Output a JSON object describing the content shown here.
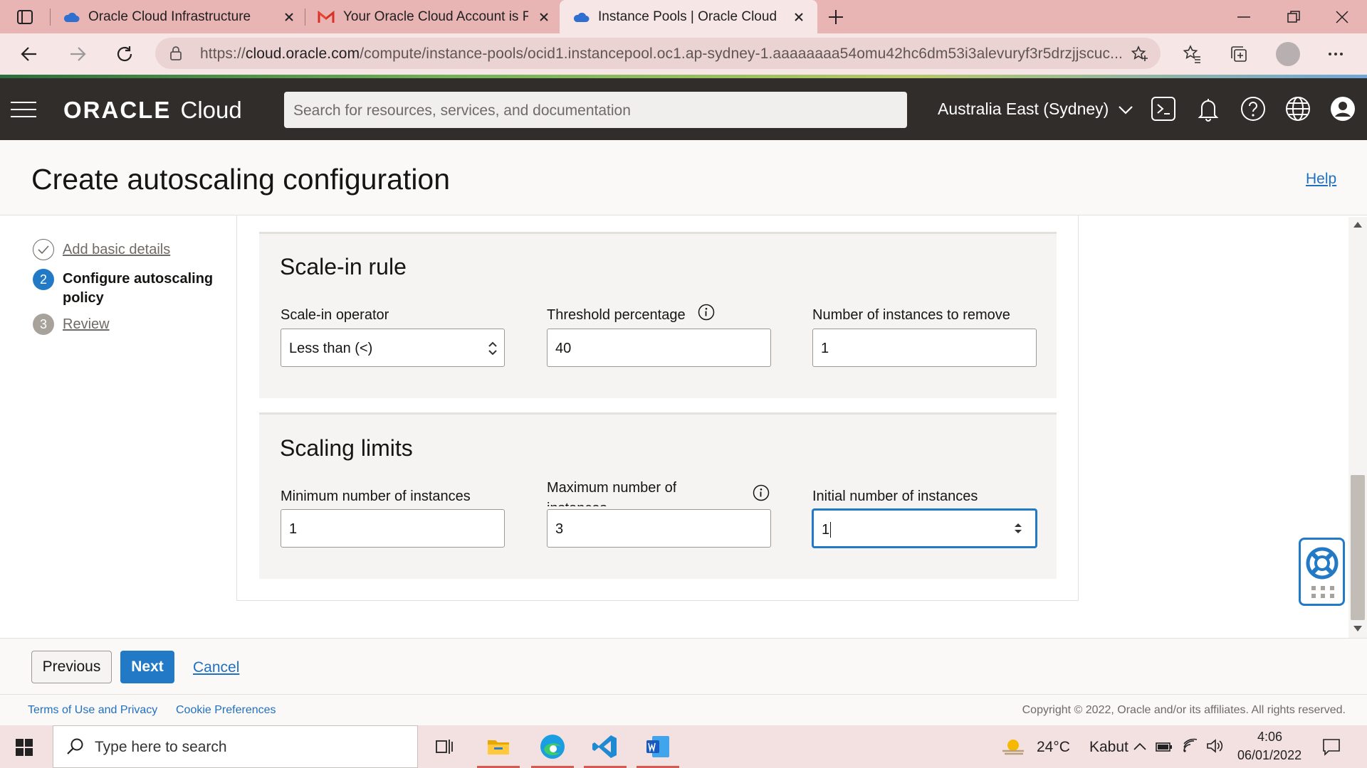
{
  "browser": {
    "tabs": [
      {
        "title": "Oracle Cloud Infrastructure | Sign In",
        "icon": "cloud-icon"
      },
      {
        "title": "Your Oracle Cloud Account is Fully Provisioned",
        "icon": "gmail-icon"
      },
      {
        "title": "Instance Pools | Oracle Cloud Infrastructure",
        "icon": "cloud-icon"
      }
    ],
    "url_prefix": "https://",
    "url_domain": "cloud.oracle.com",
    "url_path": "/compute/instance-pools/ocid1.instancepool.oc1.ap-sydney-1.aaaaaaaa54omu42hc6dm53i3alevuryf3r5drzjjscuc..."
  },
  "oracle_header": {
    "logo_word": "ORACLE",
    "logo_cloud": "Cloud",
    "search_placeholder": "Search for resources, services, and documentation",
    "region": "Australia East (Sydney)"
  },
  "page": {
    "title": "Create autoscaling configuration",
    "help": "Help"
  },
  "steps": [
    {
      "number": "✓",
      "label": "Add basic details",
      "state": "done"
    },
    {
      "number": "2",
      "label_line1": "Configure autoscaling",
      "label_line2": "policy",
      "state": "current"
    },
    {
      "number": "3",
      "label": "Review",
      "state": "upcoming"
    }
  ],
  "scale_in": {
    "heading": "Scale-in rule",
    "operator_label": "Scale-in operator",
    "operator_value": "Less than (<)",
    "threshold_label": "Threshold percentage",
    "threshold_value": "40",
    "remove_label": "Number of instances to remove",
    "remove_value": "1"
  },
  "limits": {
    "heading": "Scaling limits",
    "min_label": "Minimum number of instances",
    "min_value": "1",
    "max_label_line1": "Maximum number of",
    "max_label_line2": "instances",
    "max_value": "3",
    "initial_label": "Initial number of instances",
    "initial_value": "1"
  },
  "actions": {
    "previous": "Previous",
    "next": "Next",
    "cancel": "Cancel"
  },
  "legal": {
    "terms": "Terms of Use and Privacy",
    "cookies": "Cookie Preferences",
    "copyright": "Copyright © 2022, Oracle and/or its affiliates. All rights reserved."
  },
  "taskbar": {
    "search_placeholder": "Type here to search",
    "weather_temp": "24°C",
    "weather_desc": "Kabut",
    "time": "4:06",
    "date": "06/01/2022"
  },
  "colors": {
    "oracle_header_bg": "#312d2a",
    "primary_button": "#227ac7",
    "link": "#1f70c1",
    "tab_bar": "#e8b4b4",
    "focus_ring": "#227ac7"
  }
}
